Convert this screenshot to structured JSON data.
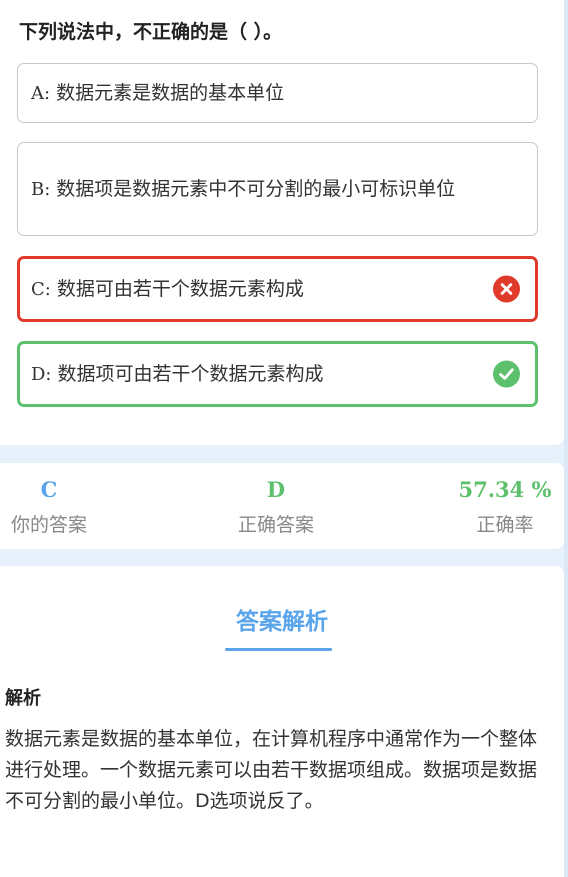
{
  "question": {
    "title": "下列说法中，不正确的是（ ）。",
    "options": [
      {
        "letter": "A:",
        "text": "数据元素是数据的基本单位",
        "state": "neutral"
      },
      {
        "letter": "B:",
        "text": "数据项是数据元素中不可分割的最小可标识单位",
        "state": "neutral"
      },
      {
        "letter": "C:",
        "text": "数据可由若干个数据元素构成",
        "state": "wrong",
        "icon": "close-circle-icon"
      },
      {
        "letter": "D:",
        "text": "数据项可由若干个数据元素构成",
        "state": "correct",
        "icon": "check-circle-icon"
      }
    ]
  },
  "stats": {
    "your_answer": {
      "value": "C",
      "label": "你的答案",
      "color": "#5aa4ec"
    },
    "correct_answer": {
      "value": "D",
      "label": "正确答案",
      "color": "#5dc06c"
    },
    "accuracy": {
      "value": "57.34 %",
      "label": "正确率",
      "color": "#5dc06c"
    }
  },
  "explanation": {
    "title": "答案解析",
    "subtitle": "解析",
    "body": "数据元素是数据的基本单位，在计算机程序中通常作为一个整体进行处理。一个数据元素可以由若干数据项组成。数据项是数据不可分割的最小单位。D选项说反了。"
  },
  "colors": {
    "accent": "#5aa4ec",
    "correct": "#5dc06c",
    "wrong": "#e03b2a",
    "background": "#e7f1fb"
  }
}
